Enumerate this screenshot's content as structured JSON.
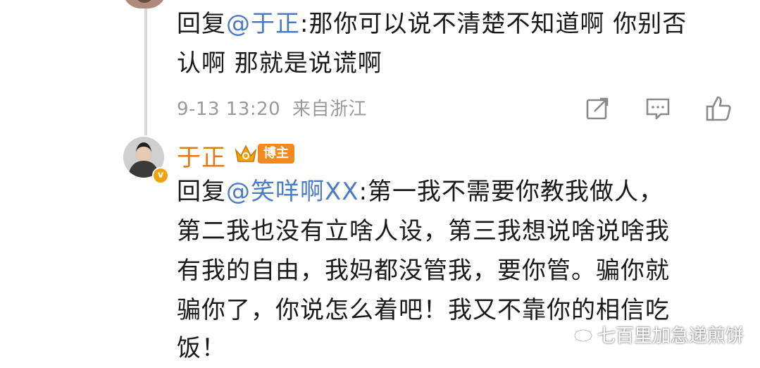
{
  "reply1": {
    "prefix": "回复",
    "mention": "@于正",
    "line1_text": ":那你可以说不清楚不知道啊 你别否",
    "line2_text": "认啊 那就是说谎啊"
  },
  "meta": {
    "timestamp": "9-13 13:20",
    "location": "来自浙江"
  },
  "actions": {
    "share_icon": "share-icon",
    "comment_icon": "comment-icon",
    "like_icon": "thumbs-up-icon"
  },
  "reply2": {
    "author": "于正",
    "author_badge": "博主",
    "verified_mark": "v",
    "prefix": "回复",
    "mention": "@笑咩啊XX",
    "line1_text": ":第一我不需要你教我做人，",
    "line2": "第二我也没有立啥人设，第三我想说啥说啥我",
    "line3": "有我的自由，我妈都没管我，要你管。骗你就",
    "line4": "骗你了，你说怎么着吧！我又不靠你的相信吃",
    "line5": "饭！"
  },
  "watermark": "七百里加急递煎饼",
  "colors": {
    "mention": "#4a7bc8",
    "author": "#e07a1a",
    "badge": "#f28a1f",
    "meta": "#9a9a9a"
  }
}
